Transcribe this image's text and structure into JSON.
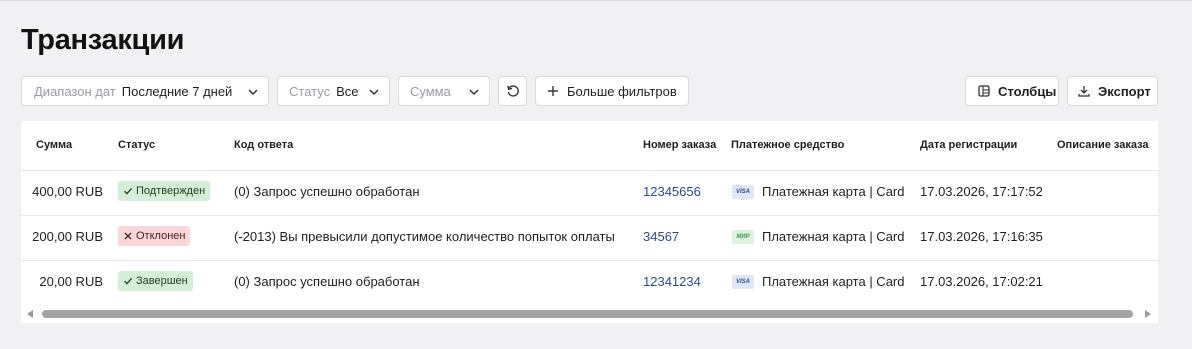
{
  "page": {
    "title": "Транзакции"
  },
  "filters": {
    "date": {
      "label": "Диапазон дат",
      "value": "Последние 7 дней"
    },
    "status": {
      "label": "Статус",
      "value": "Все"
    },
    "amount": {
      "label": "Сумма"
    },
    "more_label": "Больше фильтров"
  },
  "toolbar": {
    "columns_label": "Столбцы",
    "export_label": "Экспорт"
  },
  "table": {
    "headers": {
      "amount": "Сумма",
      "status": "Статус",
      "code": "Код ответа",
      "order": "Номер заказа",
      "payment": "Платежное средство",
      "date": "Дата регистрации",
      "description": "Описание заказа"
    },
    "rows": [
      {
        "amount": "400,00 RUB",
        "status": "Подтвержден",
        "status_type": "success",
        "code": "(0) Запрос успешно обработан",
        "order": "12345656",
        "payment_logo": "VISA",
        "payment": "Платежная карта | Card",
        "date": "17.03.2026, 17:17:52",
        "description": ""
      },
      {
        "amount": "200,00 RUB",
        "status": "Отклонен",
        "status_type": "declined",
        "code": "(-2013) Вы превысили допустимое количество попыток оплаты",
        "order": "34567",
        "payment_logo": "МИР",
        "payment": "Платежная карта | Card",
        "date": "17.03.2026, 17:16:35",
        "description": ""
      },
      {
        "amount": "20,00 RUB",
        "status": "Завершен",
        "status_type": "success",
        "code": "(0) Запрос успешно обработан",
        "order": "12341234",
        "payment_logo": "VISA",
        "payment": "Платежная карта | Card",
        "date": "17.03.2026, 17:02:21",
        "description": ""
      }
    ]
  },
  "icons": {
    "chevron": "chevron-down-icon",
    "refresh": "refresh-icon",
    "plus": "plus-icon",
    "columns": "columns-icon",
    "export": "download-icon",
    "check": "check-icon",
    "cross": "close-icon",
    "scroll_left": "arrow-left-icon",
    "scroll_right": "arrow-right-icon"
  },
  "colors": {
    "background": "#f1f1f3",
    "order_link": "#2c4a8c",
    "success_badge": "#d3f0d6",
    "declined_badge": "#fbd6d8",
    "scroll_thumb": "#a4a4a8"
  }
}
